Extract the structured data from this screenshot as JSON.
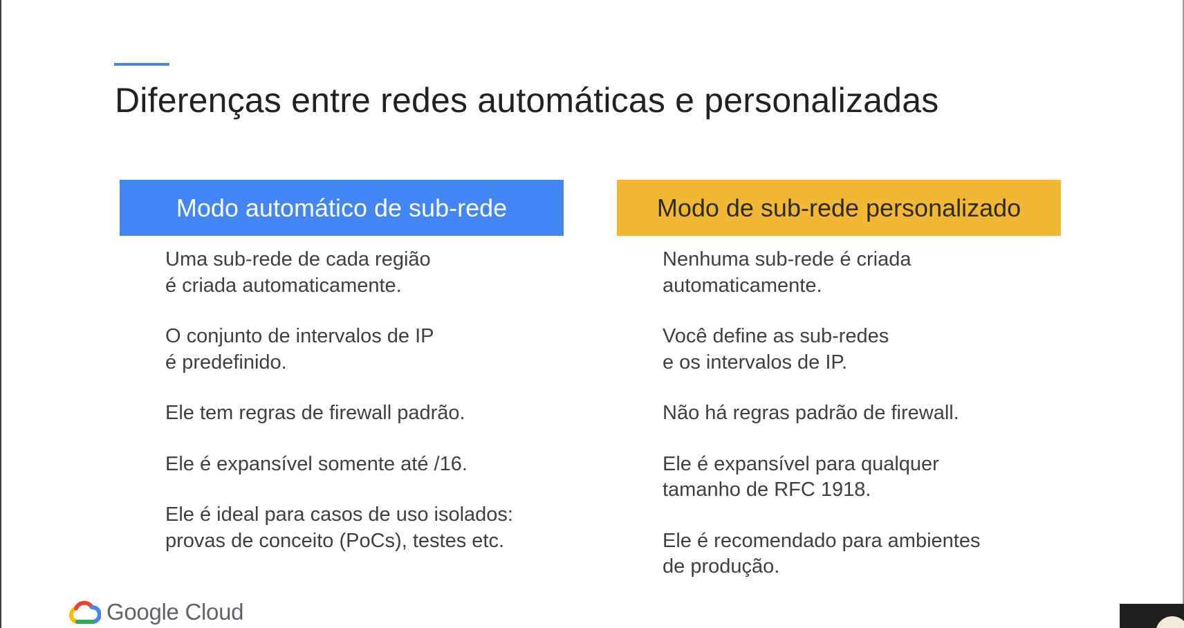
{
  "slide": {
    "title": "Diferenças entre redes automáticas e personalizadas",
    "accent_color": "#4285f4"
  },
  "columns": [
    {
      "header": "Modo automático de sub-rede",
      "header_color": "#4285f4",
      "items": [
        "Uma sub-rede de cada região\né criada automaticamente.",
        "O conjunto de intervalos de IP\né predefinido.",
        "Ele tem regras de firewall padrão.",
        "Ele é expansível somente até /16.",
        "Ele é ideal para casos de uso isolados:\nprovas de conceito (PoCs), testes etc."
      ]
    },
    {
      "header": "Modo de sub-rede personalizado",
      "header_color": "#f2b733",
      "items": [
        "Nenhuma sub-rede é criada\nautomaticamente.",
        "Você define as sub-redes\ne os intervalos de IP.",
        "Não há regras padrão de firewall.",
        "Ele é expansível para qualquer\ntamanho de RFC 1918.",
        "Ele é recomendado para ambientes\nde produção."
      ]
    }
  ],
  "footer": {
    "logo_icon": "google-cloud-icon",
    "logo_text": "Google Cloud"
  }
}
